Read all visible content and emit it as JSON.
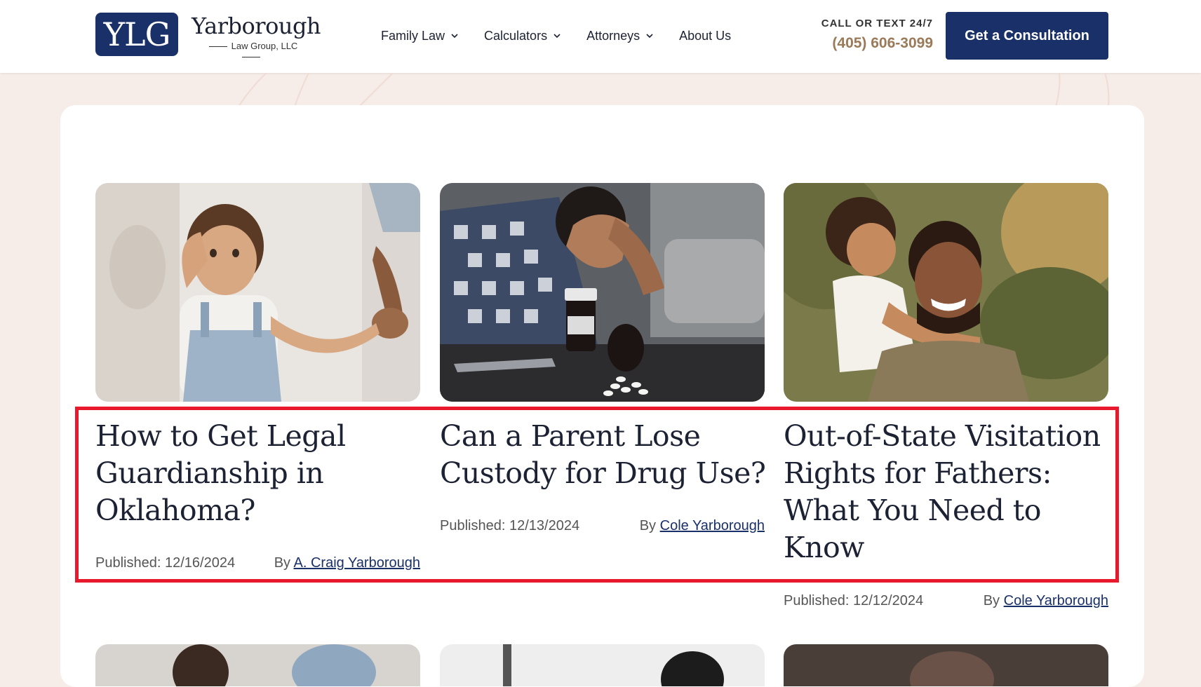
{
  "header": {
    "logo_mark": "YLG",
    "logo_name": "Yarborough",
    "logo_subtitle": "Law Group, LLC",
    "nav": [
      {
        "label": "Family Law",
        "dropdown": true
      },
      {
        "label": "Calculators",
        "dropdown": true
      },
      {
        "label": "Attorneys",
        "dropdown": true
      },
      {
        "label": "About Us",
        "dropdown": false
      }
    ],
    "call_label": "CALL OR TEXT 24/7",
    "phone": "(405) 606-3099",
    "cta_label": "Get a Consultation"
  },
  "posts": [
    {
      "title": "How to Get Legal Guardianship in Oklahoma?",
      "published_label": "Published:",
      "date": "12/16/2024",
      "by_label": "By",
      "author": "A. Craig Yarborough",
      "image": "toddler-holding-parent-hand-photo"
    },
    {
      "title": "Can a Parent Lose Custody for Drug Use?",
      "published_label": "Published:",
      "date": "12/13/2024",
      "by_label": "By",
      "author": "Cole Yarborough",
      "image": "man-with-pills-on-table-photo"
    },
    {
      "title": "Out-of-State Visitation Rights for Fathers: What You Need to Know",
      "published_label": "Published:",
      "date": "12/12/2024",
      "by_label": "By",
      "author": "Cole Yarborough",
      "image": "child-hugging-father-photo"
    }
  ],
  "colors": {
    "brand_navy": "#1a3068",
    "phone_gold": "#9a7a58",
    "page_bg": "#f6ece8",
    "highlight_red": "#e8192c"
  }
}
